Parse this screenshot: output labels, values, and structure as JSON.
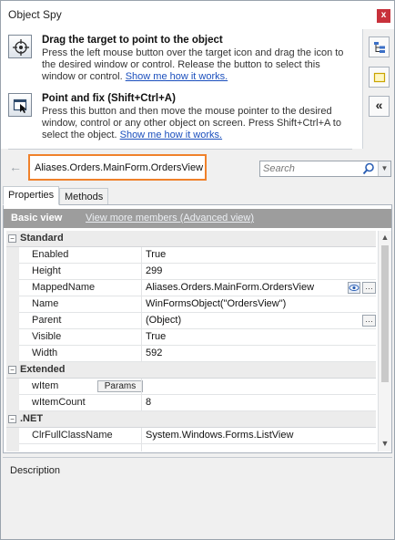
{
  "window": {
    "title": "Object Spy",
    "close_label": "x"
  },
  "instructions": [
    {
      "heading": "Drag the target to point to the object",
      "text": "Press the left mouse button over the target icon and drag the icon to the desired window or control. Release the button to select this window or control. ",
      "link": "Show me how it works."
    },
    {
      "heading": "Point and fix (Shift+Ctrl+A)",
      "text": "Press this button and then move the mouse pointer to the desired window, control or any other object on screen. Press Shift+Ctrl+A to select the object. ",
      "link": "Show me how it works."
    }
  ],
  "address": {
    "back_icon": "back-arrow-icon",
    "object_path": "Aliases.Orders.MainForm.OrdersView"
  },
  "search": {
    "placeholder": "Search"
  },
  "tabs": [
    {
      "label": "Properties"
    },
    {
      "label": "Methods"
    }
  ],
  "panel": {
    "title": "Basic view",
    "advanced_link": "View more members (Advanced view)"
  },
  "grid": {
    "categories": [
      {
        "name": "Standard",
        "rows": [
          {
            "name": "Enabled",
            "value": "True"
          },
          {
            "name": "Height",
            "value": "299"
          },
          {
            "name": "MappedName",
            "value": "Aliases.Orders.MainForm.OrdersView"
          },
          {
            "name": "Name",
            "value": "WinFormsObject(\"OrdersView\")"
          },
          {
            "name": "Parent",
            "value": "(Object)"
          },
          {
            "name": "Visible",
            "value": "True"
          },
          {
            "name": "Width",
            "value": "592"
          }
        ]
      },
      {
        "name": "Extended",
        "rows": [
          {
            "name": "wItem",
            "value": "",
            "button": "Params"
          },
          {
            "name": "wItemCount",
            "value": "8"
          }
        ]
      },
      {
        "name": ".NET",
        "rows": [
          {
            "name": "ClrFullClassName",
            "value": "System.Windows.Forms.ListView"
          }
        ]
      }
    ],
    "ellipsis_label": "…",
    "collapse_label": "−"
  },
  "description": {
    "label": "Description"
  }
}
